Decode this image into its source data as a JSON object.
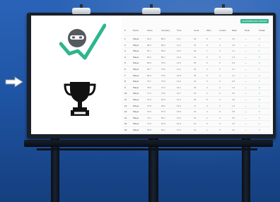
{
  "scene": {
    "arrow_icon": "right-arrow-icon",
    "lamp_count": 3,
    "left_icons": [
      "robot-checkmark-icon",
      "trophy-icon"
    ]
  },
  "leaderboard": {
    "button_label": "LEADERBOARD REPORT",
    "sub_label": "",
    "columns": [
      "#",
      "Name",
      "Score",
      "Accuracy",
      "Time",
      "Level",
      "Wins",
      "Losses",
      "Ratio",
      "Rank",
      "Streak"
    ],
    "rows": [
      [
        "1",
        "Player",
        "91.3",
        "88.4",
        "12.1",
        "34",
        "8",
        "3",
        "2.6",
        "—",
        "3"
      ],
      [
        "2",
        "Player",
        "89.0",
        "85.2",
        "11.4",
        "31",
        "6",
        "4",
        "1.8",
        "—",
        "2"
      ],
      [
        "3",
        "Player",
        "87.1",
        "83.9",
        "10.9",
        "29",
        "7",
        "5",
        "1.4",
        "—",
        "1"
      ],
      [
        "4",
        "Player",
        "84.2",
        "80.1",
        "13.0",
        "27",
        "5",
        "5",
        "1.0",
        "—",
        "0"
      ],
      [
        "5",
        "Player",
        "83.0",
        "78.4",
        "12.5",
        "25",
        "6",
        "3",
        "2.0",
        "—",
        "4"
      ],
      [
        "6",
        "Player",
        "81.7",
        "76.8",
        "14.2",
        "23",
        "4",
        "6",
        "0.7",
        "—",
        "1"
      ],
      [
        "7",
        "Player",
        "80.3",
        "75.0",
        "13.8",
        "22",
        "5",
        "4",
        "1.2",
        "—",
        "2"
      ],
      [
        "8",
        "Player",
        "79.1",
        "73.6",
        "12.9",
        "21",
        "3",
        "5",
        "0.6",
        "—",
        "1"
      ],
      [
        "9",
        "Player",
        "78.5",
        "72.4",
        "15.1",
        "20",
        "4",
        "4",
        "1.0",
        "—",
        "0"
      ],
      [
        "10",
        "Player",
        "77.2",
        "70.9",
        "14.7",
        "19",
        "2",
        "6",
        "0.3",
        "—",
        "1"
      ],
      [
        "11",
        "Player",
        "76.0",
        "69.5",
        "13.4",
        "18",
        "5",
        "2",
        "2.5",
        "—",
        "3"
      ],
      [
        "12",
        "Player",
        "74.8",
        "68.2",
        "16.0",
        "17",
        "3",
        "3",
        "1.0",
        "—",
        "1"
      ],
      [
        "13",
        "Player",
        "73.6",
        "67.0",
        "15.5",
        "16",
        "4",
        "5",
        "0.8",
        "—",
        "0"
      ],
      [
        "14",
        "Player",
        "72.1",
        "65.7",
        "14.9",
        "15",
        "2",
        "4",
        "0.5",
        "—",
        "2"
      ],
      [
        "15",
        "Player",
        "71.0",
        "64.3",
        "16.4",
        "14",
        "3",
        "2",
        "1.5",
        "—",
        "1"
      ],
      [
        "16",
        "Player",
        "69.8",
        "63.1",
        "17.0",
        "13",
        "1",
        "5",
        "0.2",
        "—",
        "0"
      ],
      [
        "17",
        "Player",
        "68.5",
        "61.8",
        "16.8",
        "12",
        "2",
        "3",
        "0.7",
        "—",
        "1"
      ],
      [
        "18",
        "Player",
        "67.3",
        "60.4",
        "18.1",
        "11",
        "3",
        "4",
        "0.8",
        "—",
        "2"
      ],
      [
        "19",
        "Player",
        "66.0",
        "59.2",
        "17.7",
        "10",
        "1",
        "2",
        "0.5",
        "—",
        "0"
      ],
      [
        "20",
        "Player",
        "64.9",
        "58.0",
        "18.9",
        "9",
        "2",
        "3",
        "0.7",
        "—",
        "1"
      ]
    ]
  },
  "colors": {
    "accent": "#2fb58f",
    "sky": "#1f55a6"
  }
}
